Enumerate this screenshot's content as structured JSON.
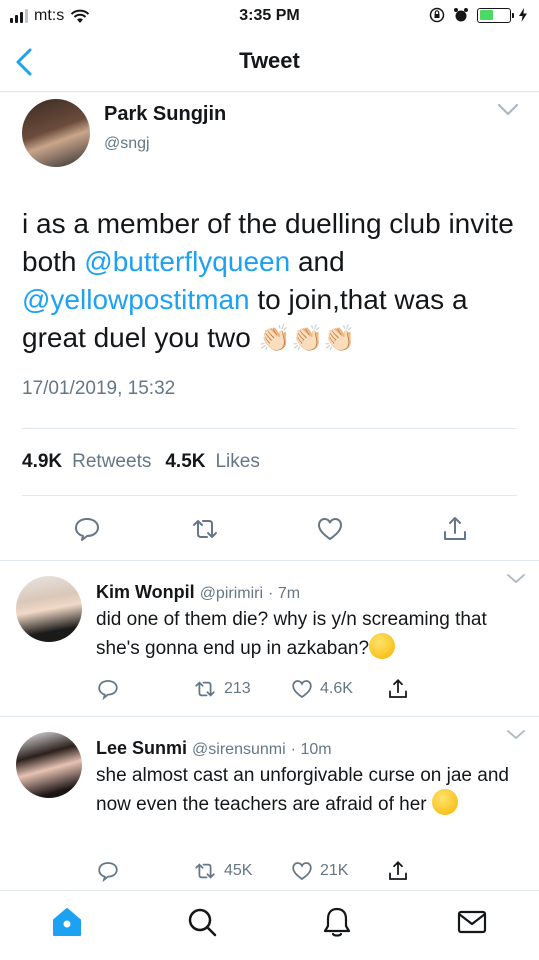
{
  "status_bar": {
    "carrier": "mt:s",
    "time": "3:35 PM",
    "battery_color": "#4cd964"
  },
  "nav": {
    "title": "Tweet",
    "back_icon": "chevron-left-icon"
  },
  "main_tweet": {
    "author_name": "Park Sungjin",
    "author_handle": "@sngj",
    "text_part1": "i as a member of the duelling club invite both ",
    "mention1": "@butterflyqueen",
    "text_part2": " and ",
    "mention2": "@yellowpostitman",
    "text_part3": " to join,that was a great duel you two ",
    "emoji": "👏🏻👏🏻👏🏻",
    "date": "17/01/2019, 15:32",
    "retweets_count": "4.9K",
    "retweets_label": "Retweets",
    "likes_count": "4.5K",
    "likes_label": "Likes",
    "accent_color": "#1da1f2"
  },
  "replies": [
    {
      "author_name": "Kim Wonpil",
      "author_handle": "@pirimiri",
      "time": "· 7m",
      "text": "did one of them die? why is y/n screaming that she's gonna end up in azkaban?",
      "retweets": "213",
      "likes": "4.6K"
    },
    {
      "author_name": "Lee Sunmi",
      "author_handle": "@sirensunmi",
      "time": "· 10m",
      "text": "she almost cast an unforgivable curse on jae and now even the teachers are afraid of her",
      "retweets": "45K",
      "likes": "21K"
    }
  ],
  "tab_bar": {
    "items": [
      "home-icon",
      "search-icon",
      "notifications-icon",
      "messages-icon"
    ],
    "active_color": "#1da1f2"
  }
}
